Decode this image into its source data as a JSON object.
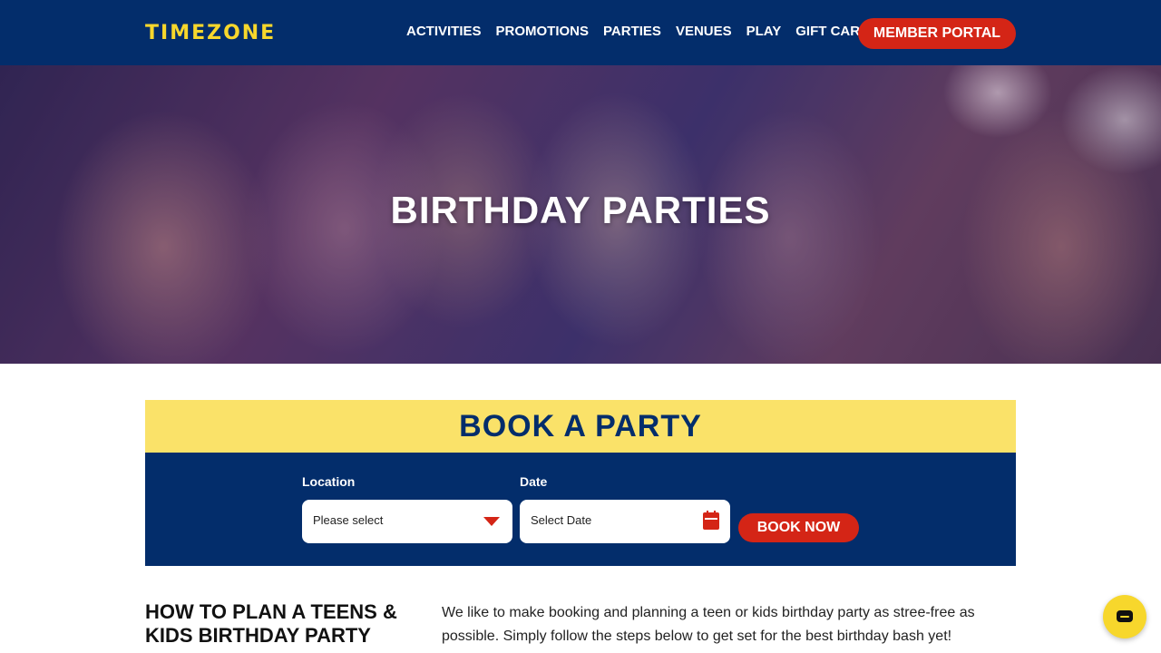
{
  "header": {
    "logo": "TIMEZONE",
    "nav": [
      "ACTIVITIES",
      "PROMOTIONS",
      "PARTIES",
      "VENUES",
      "PLAY",
      "GIFT CARDS"
    ],
    "member_portal": "MEMBER PORTAL"
  },
  "hero": {
    "title": "BIRTHDAY PARTIES"
  },
  "booking": {
    "title": "BOOK A PARTY",
    "location_label": "Location",
    "location_value": "Please select",
    "date_label": "Date",
    "date_value": "Select Date",
    "button": "BOOK NOW"
  },
  "content": {
    "heading": "HOW TO PLAN A TEENS & KIDS BIRTHDAY PARTY",
    "intro": "We like to make booking and planning a teen or kids birthday party as stree-free as possible. Simply follow the steps below to get set for the best birthday bash yet!"
  },
  "colors": {
    "navy": "#032d6b",
    "yellow": "#fae269",
    "red": "#d42516",
    "logo_yellow": "#f7d72c"
  },
  "icons": {
    "location_dropdown": "chevron-down-icon",
    "date_picker": "calendar-icon",
    "chat": "chat-icon"
  }
}
